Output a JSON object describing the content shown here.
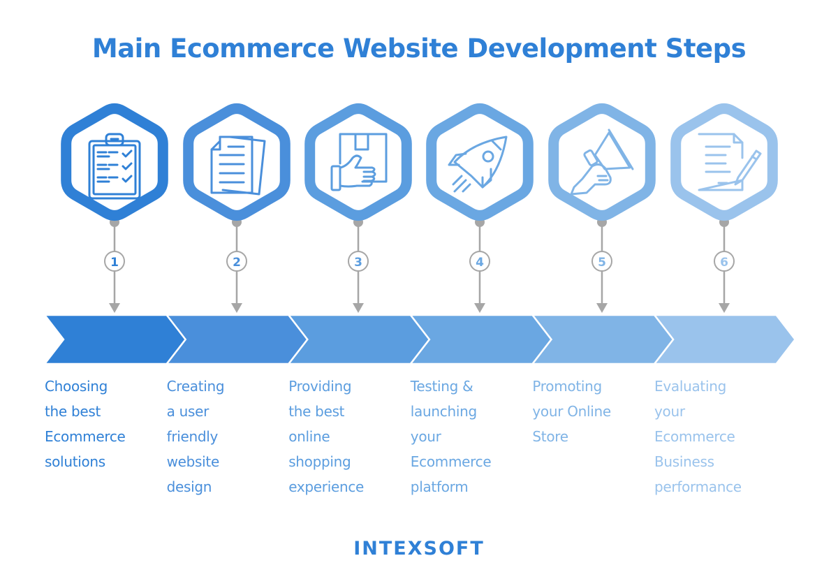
{
  "title": "Main Ecommerce Website Development Steps",
  "colors": {
    "title": "#2f80d6",
    "connector": "#a6a6a6",
    "number_circle_border": "#a6a6a6"
  },
  "steps": [
    {
      "number": "1",
      "icon": "clipboard-checklist-icon",
      "color": "#2f80d6",
      "label": "Choosing\nthe best\nEcommerce\nsolutions"
    },
    {
      "number": "2",
      "icon": "documents-icon",
      "color": "#4a8fdb",
      "label": "Creating\n a user\nfriendly\nwebsite\ndesign"
    },
    {
      "number": "3",
      "icon": "hand-package-icon",
      "color": "#5b9ddf",
      "label": "Providing\nthe best\nonline\nshopping\nexperience"
    },
    {
      "number": "4",
      "icon": "rocket-icon",
      "color": "#6aa7e2",
      "label": "Testing &\nlaunching\nyour\nEcommerce\nplatform"
    },
    {
      "number": "5",
      "icon": "megaphone-icon",
      "color": "#80b4e6",
      "label": "Promoting\nyour Online\nStore"
    },
    {
      "number": "6",
      "icon": "document-pen-icon",
      "color": "#9ac3ec",
      "label": "Evaluating\nyour\nEcommerce\nBusiness\nperformance"
    }
  ],
  "logo": "INTEXSOFT"
}
